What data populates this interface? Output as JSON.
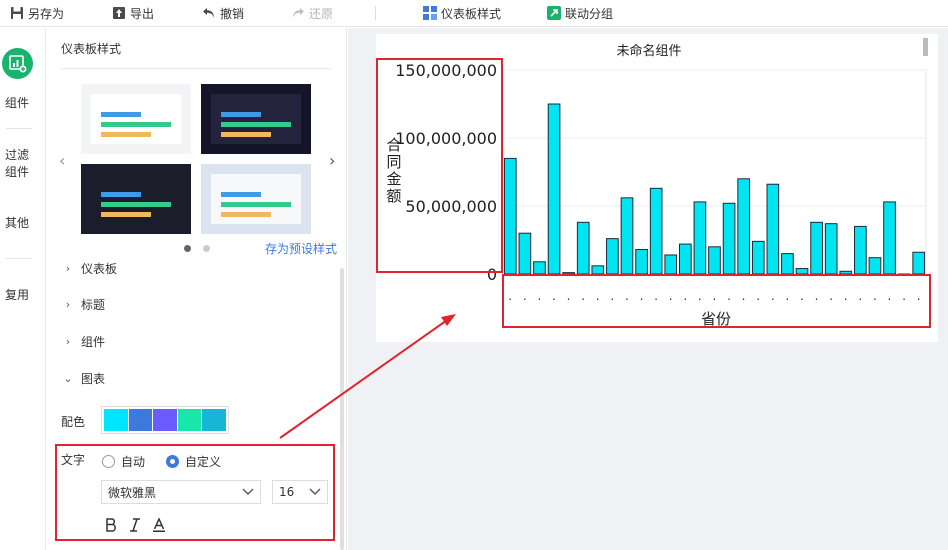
{
  "toolbar": {
    "save_as": "另存为",
    "export": "导出",
    "undo": "撤销",
    "redo": "还原",
    "dashboard_style": "仪表板样式",
    "linked_group": "联动分组"
  },
  "rail": {
    "components": "组件",
    "filter_components": "过滤\n组件",
    "others": "其他",
    "reuse": "复用"
  },
  "panel": {
    "title": "仪表板样式",
    "save_preset": "存为预设样式",
    "sections": [
      "仪表板",
      "标题",
      "组件",
      "图表"
    ],
    "color_label": "配色",
    "palette": [
      "#00e5ff",
      "#3d7ae0",
      "#6a5cff",
      "#19e6a8",
      "#17b6d6"
    ],
    "text_label": "文字",
    "text_modes": [
      "自动",
      "自定义"
    ],
    "font_family": "微软雅黑",
    "font_size": "16",
    "format_icons": [
      "bold-icon",
      "italic-icon",
      "font-color-icon"
    ]
  },
  "widget": {
    "title": "未命名组件",
    "chart_data": {
      "type": "bar",
      "title": "未命名组件",
      "xlabel": "省份",
      "ylabel": "合同金额",
      "ylim": [
        0,
        150000000
      ],
      "ytick_labels": [
        "0",
        "50,000,000",
        "100,000,000",
        "150,000,000"
      ],
      "bar_color": "#00e5f2",
      "grid": "horizontal",
      "values": [
        85000000,
        30000000,
        9000000,
        125000000,
        1000000,
        38000000,
        6000000,
        26000000,
        56000000,
        18000000,
        63000000,
        14000000,
        22000000,
        53000000,
        20000000,
        52000000,
        70000000,
        24000000,
        66000000,
        15000000,
        4000000,
        38000000,
        37000000,
        2000000,
        35000000,
        12000000,
        53000000,
        0,
        16000000
      ]
    }
  }
}
